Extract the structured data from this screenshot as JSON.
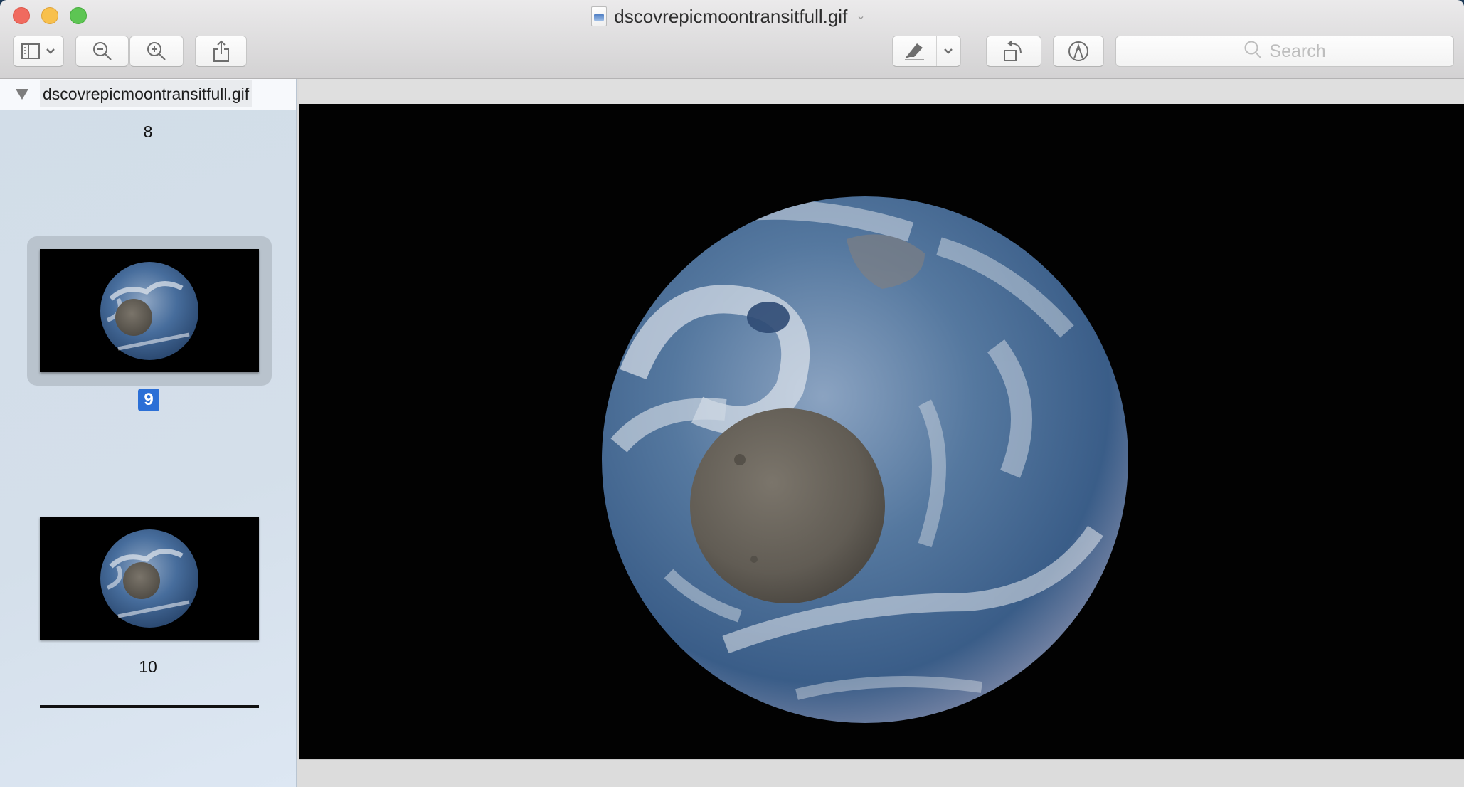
{
  "window": {
    "title": "dscovrepicmoontransitfull.gif",
    "traffic_lights": [
      "close",
      "minimize",
      "zoom"
    ]
  },
  "toolbar": {
    "sidebar_button": {
      "icon": "sidebar-icon",
      "has_menu": true
    },
    "zoom_out": {
      "icon": "zoom-out-icon"
    },
    "zoom_in": {
      "icon": "zoom-in-icon"
    },
    "share": {
      "icon": "share-icon"
    },
    "markup_toolbar": {
      "icon": "pen-icon",
      "has_menu": true
    },
    "rotate": {
      "icon": "rotate-left-icon"
    },
    "annotate": {
      "icon": "markup-icon"
    },
    "search": {
      "placeholder": "Search",
      "value": ""
    }
  },
  "sidebar": {
    "document_name": "dscovrepicmoontransitfull.gif",
    "pages": [
      {
        "label": "8",
        "selected": false
      },
      {
        "label": "9",
        "selected": true
      },
      {
        "label": "10",
        "selected": false
      }
    ]
  },
  "viewer": {
    "current_frame": "9",
    "content": "Earth seen from deep space with the Moon transiting in front"
  },
  "colors": {
    "selection_badge": "#2b6fd6",
    "sidebar_bg": "#d3dee9",
    "viewer_bg": "#020202",
    "close": "#f06a5f",
    "minimize": "#f8c04c",
    "zoom": "#5dc553"
  }
}
